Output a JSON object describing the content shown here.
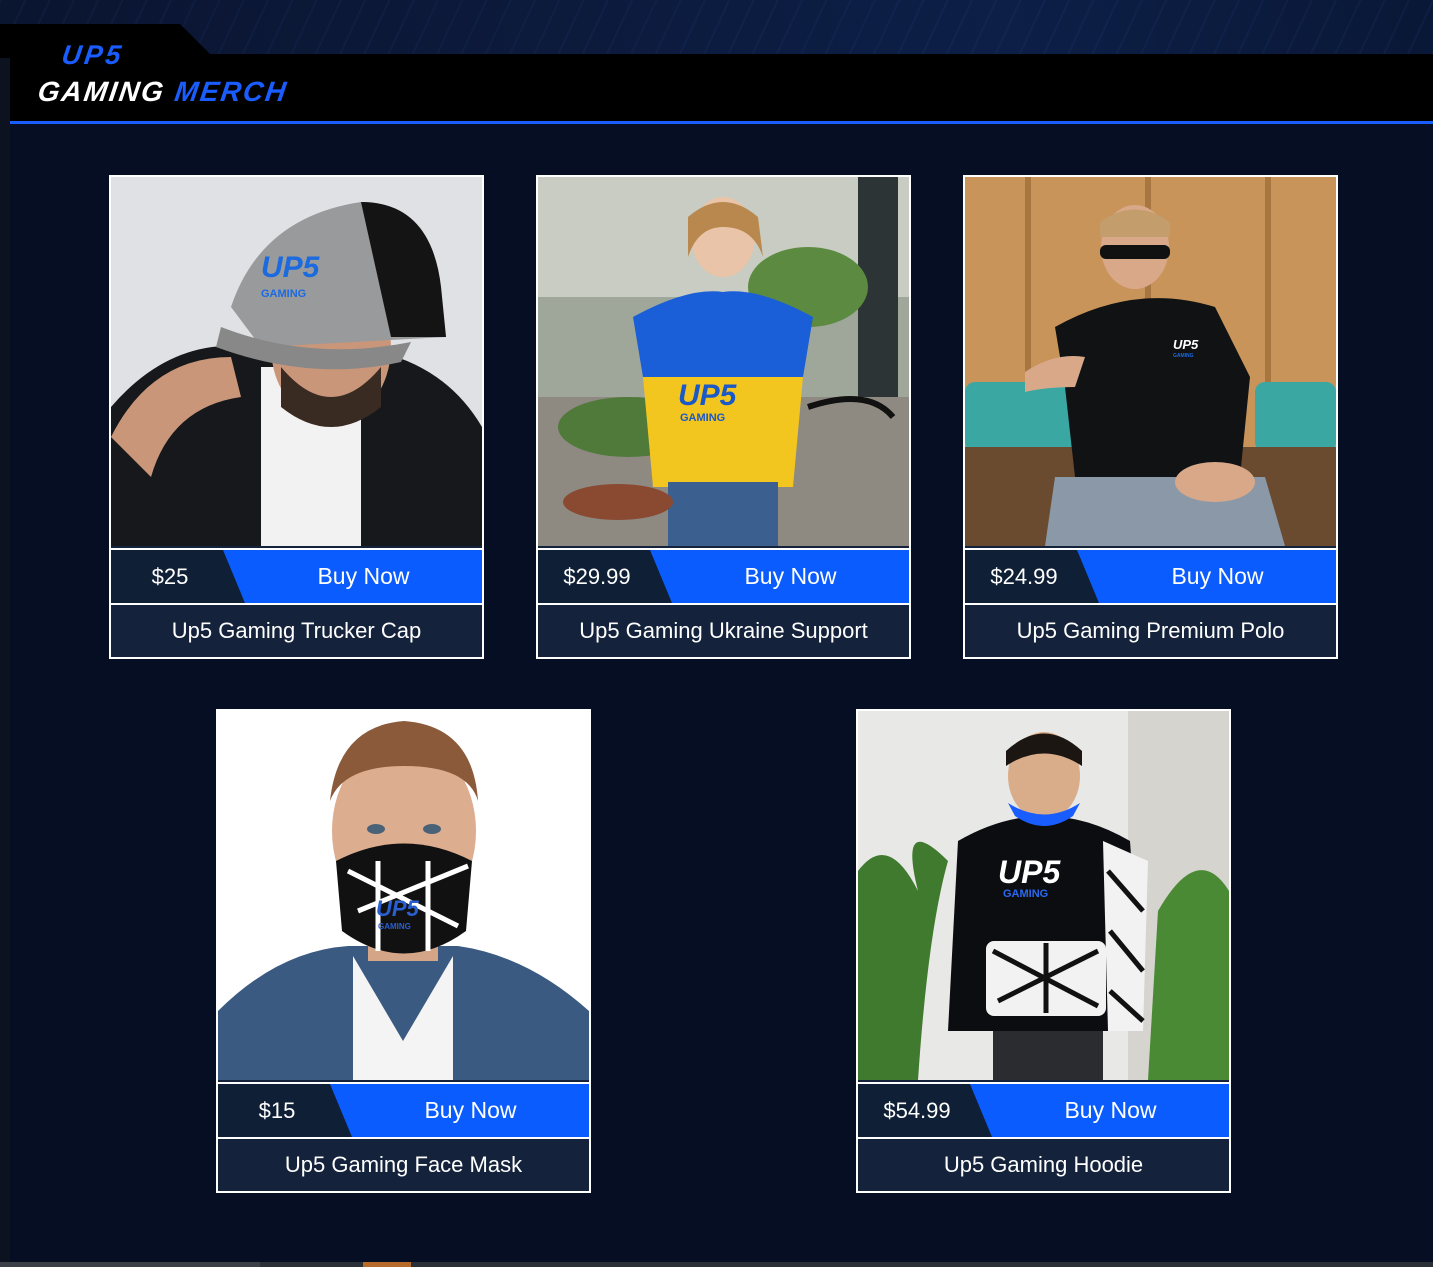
{
  "brand": {
    "logo_line1": "UP5",
    "logo_word1": "GAMING",
    "logo_word2": "MERCH",
    "accent_color": "#1a5dff",
    "button_color": "#0b5cff",
    "background_color": "#050e23"
  },
  "products": [
    {
      "price": "$25",
      "buy_label": "Buy Now",
      "title": "Up5 Gaming Trucker Cap",
      "image": "trucker-cap-photo",
      "image_text": [
        "UP5",
        "GAMING"
      ]
    },
    {
      "price": "$29.99",
      "buy_label": "Buy Now",
      "title": "Up5 Gaming Ukraine Support",
      "image": "ukraine-shirt-photo",
      "image_text": [
        "UP5",
        "GAMING"
      ]
    },
    {
      "price": "$24.99",
      "buy_label": "Buy Now",
      "title": "Up5 Gaming Premium Polo",
      "image": "polo-shirt-photo",
      "image_text": [
        "UP5",
        "GAMING"
      ]
    },
    {
      "price": "$15",
      "buy_label": "Buy Now",
      "title": "Up5 Gaming Face Mask",
      "image": "face-mask-photo",
      "image_text": [
        "UP5",
        "GAMING"
      ]
    },
    {
      "price": "$54.99",
      "buy_label": "Buy Now",
      "title": "Up5 Gaming Hoodie",
      "image": "hoodie-photo",
      "image_text": [
        "UP5",
        "GAMING"
      ]
    }
  ]
}
